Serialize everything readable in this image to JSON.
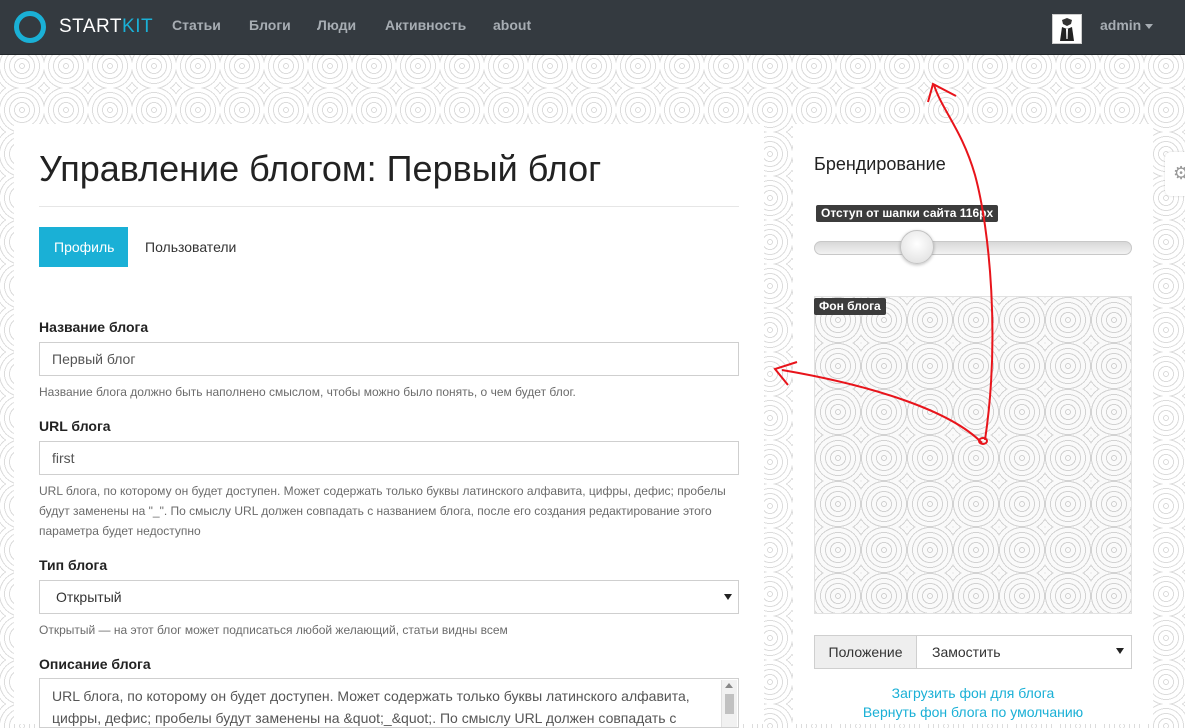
{
  "navbar": {
    "brand_start": "START",
    "brand_kit": "KIT",
    "links": [
      "Статьи",
      "Блоги",
      "Люди",
      "Активность",
      "about"
    ],
    "user": "admin",
    "avatar_icon": "user-avatar-icon"
  },
  "main": {
    "title": "Управление блогом: Первый блог",
    "tabs": [
      {
        "label": "Профиль",
        "active": true
      },
      {
        "label": "Пользователи",
        "active": false
      }
    ],
    "fields": {
      "name": {
        "label": "Название блога",
        "value": "Первый блог",
        "hint": "Название блога должно быть наполнено смыслом, чтобы можно было понять, о чем будет блог."
      },
      "url": {
        "label": "URL блога",
        "value": "first",
        "hint": "URL блога, по которому он будет доступен. Может содержать только буквы латинского алфавита, цифры, дефис; пробелы будут заменены на \"_\". По смыслу URL должен совпадать с названием блога, после его создания редактирование этого параметра будет недоступно"
      },
      "type": {
        "label": "Тип блога",
        "value": "Открытый",
        "hint": "Открытый — на этот блог может подписаться любой желающий, статьи видны всем"
      },
      "description": {
        "label": "Описание блога",
        "value": "URL блога, по которому он будет доступен. Может содержать только буквы латинского алфавита, цифры, дефис; пробелы будут заменены на &quot;_&quot;. По смыслу URL должен совпадать с"
      }
    }
  },
  "sidebar": {
    "title": "Брендирование",
    "offset_badge": "Отступ от шапки сайта 116px",
    "offset_value": 116,
    "bg_badge": "Фон блога",
    "position_label": "Положение",
    "position_value": "Замостить",
    "upload_link": "Загрузить фон для блога",
    "reset_link": "Вернуть фон блога по умолчанию"
  },
  "colors": {
    "accent": "#1ab0d6",
    "navbar": "#343a40",
    "annotation": "#e8141b"
  }
}
